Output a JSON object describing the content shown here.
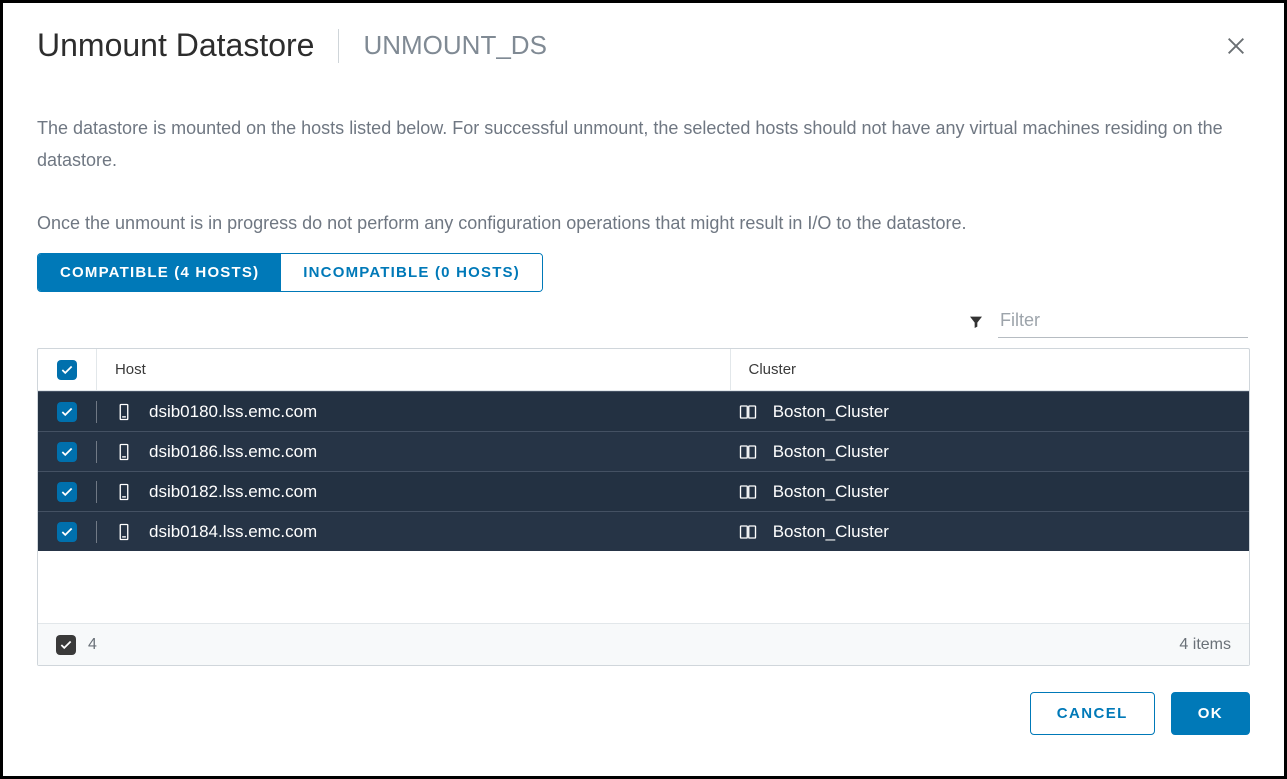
{
  "header": {
    "title": "Unmount Datastore",
    "subtitle": "UNMOUNT_DS"
  },
  "description": {
    "line1": "The datastore is mounted on the hosts listed below. For successful unmount, the selected hosts should not have any virtual machines residing on the datastore.",
    "line2": "Once the unmount is in progress do not perform any configuration operations that might result in I/O to the datastore."
  },
  "tabs": {
    "compatible": "COMPATIBLE (4 HOSTS)",
    "incompatible": "INCOMPATIBLE (0 HOSTS)"
  },
  "filter": {
    "placeholder": "Filter"
  },
  "table": {
    "columns": {
      "host": "Host",
      "cluster": "Cluster"
    },
    "rows": [
      {
        "host": "dsib0180.lss.emc.com",
        "cluster": "Boston_Cluster"
      },
      {
        "host": "dsib0186.lss.emc.com",
        "cluster": "Boston_Cluster"
      },
      {
        "host": "dsib0182.lss.emc.com",
        "cluster": "Boston_Cluster"
      },
      {
        "host": "dsib0184.lss.emc.com",
        "cluster": "Boston_Cluster"
      }
    ],
    "selected_count": "4",
    "items_label": "4 items"
  },
  "buttons": {
    "cancel": "CANCEL",
    "ok": "OK"
  }
}
